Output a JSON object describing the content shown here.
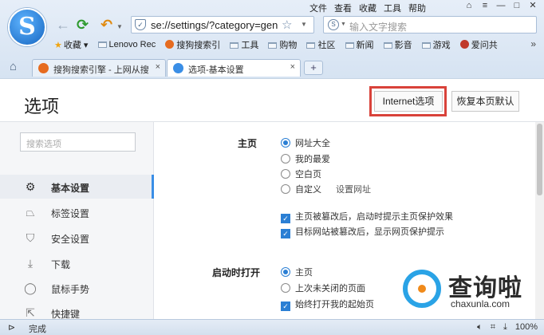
{
  "browser": {
    "logo_letter": "S",
    "menu": [
      "文件",
      "查看",
      "收藏",
      "工具",
      "帮助"
    ],
    "address": "se://settings/?category=gen",
    "search_placeholder": "输入文字搜索",
    "bookmarks": [
      {
        "label": "收藏",
        "icon": "star-icon"
      },
      {
        "label": "Lenovo Rec",
        "icon": "folder-icon"
      },
      {
        "label": "搜狗搜索引",
        "icon": "folder-icon"
      },
      {
        "label": "工具",
        "icon": "folder-icon"
      },
      {
        "label": "购物",
        "icon": "folder-icon"
      },
      {
        "label": "社区",
        "icon": "folder-icon"
      },
      {
        "label": "新闻",
        "icon": "folder-icon"
      },
      {
        "label": "影音",
        "icon": "folder-icon"
      },
      {
        "label": "游戏",
        "icon": "folder-icon"
      },
      {
        "label": "爱问共",
        "icon": "avatar-icon"
      }
    ],
    "more_bookmarks": "»",
    "tabs": [
      {
        "label": "搜狗搜索引擎 - 上网从搜",
        "active": false
      },
      {
        "label": "选项-基本设置",
        "active": true
      }
    ],
    "new_tab": "+"
  },
  "page": {
    "title": "选项",
    "internet_options_button": "Internet选项",
    "restore_defaults_button": "恢复本页默认",
    "sidebar": {
      "search_placeholder": "搜索选项",
      "items": [
        {
          "label": "基本设置",
          "icon": "gear-icon",
          "active": true
        },
        {
          "label": "标签设置",
          "icon": "tab-icon",
          "active": false
        },
        {
          "label": "安全设置",
          "icon": "shield-icon",
          "active": false
        },
        {
          "label": "下载",
          "icon": "download-icon",
          "active": false
        },
        {
          "label": "鼠标手势",
          "icon": "mouse-icon",
          "active": false
        },
        {
          "label": "快捷键",
          "icon": "shortcut-icon",
          "active": false
        }
      ]
    },
    "homepage": {
      "label": "主页",
      "options": [
        {
          "label": "网址大全",
          "checked": true
        },
        {
          "label": "我的最爱",
          "checked": false
        },
        {
          "label": "空白页",
          "checked": false
        },
        {
          "label": "自定义",
          "checked": false,
          "link": "设置网址"
        }
      ],
      "checks": [
        {
          "label": "主页被篡改后，启动时提示主页保护效果",
          "checked": true
        },
        {
          "label": "目标网站被篡改后，显示网页保护提示",
          "checked": true
        }
      ]
    },
    "startup": {
      "label": "启动时打开",
      "options": [
        {
          "label": "主页",
          "checked": true
        },
        {
          "label": "上次未关闭的页面",
          "checked": false
        }
      ],
      "checks": [
        {
          "label": "始终打开我的起始页",
          "checked": true
        }
      ]
    }
  },
  "watermark": {
    "text": "查询啦",
    "url": "chaxunla.com"
  },
  "status": {
    "text": "完成",
    "zoom": "100%",
    "accent": "#2b7fd4"
  }
}
